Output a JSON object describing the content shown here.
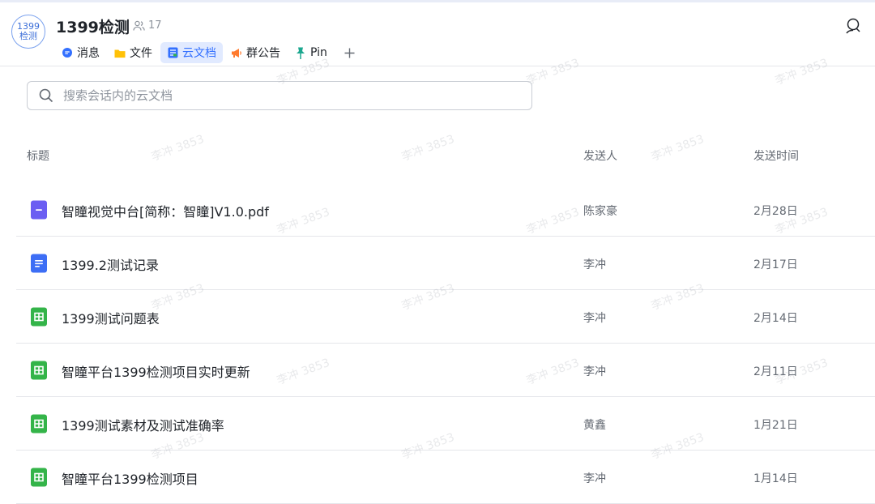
{
  "header": {
    "avatar_line1": "1399",
    "avatar_line2": "检测",
    "group_name": "1399检测",
    "member_count": "17"
  },
  "tabs": [
    {
      "label": "消息",
      "icon": "message-icon",
      "active": false
    },
    {
      "label": "文件",
      "icon": "folder-icon",
      "active": false
    },
    {
      "label": "云文档",
      "icon": "doc-icon",
      "active": true
    },
    {
      "label": "群公告",
      "icon": "announcement-icon",
      "active": false
    },
    {
      "label": "Pin",
      "icon": "pin-icon",
      "active": false
    }
  ],
  "search": {
    "placeholder": "搜索会话内的云文档"
  },
  "table": {
    "headers": {
      "title": "标题",
      "sender": "发送人",
      "time": "发送时间"
    },
    "rows": [
      {
        "type": "pdf",
        "icon": "pdf-file-icon",
        "title": "智瞳视觉中台[简称：智瞳]V1.0.pdf",
        "sender": "陈家豪",
        "time": "2月28日"
      },
      {
        "type": "doc",
        "icon": "doc-file-icon",
        "title": "1399.2测试记录",
        "sender": "李冲",
        "time": "2月17日"
      },
      {
        "type": "sheet",
        "icon": "sheet-file-icon",
        "title": "1399测试问题表",
        "sender": "李冲",
        "time": "2月14日"
      },
      {
        "type": "sheet",
        "icon": "sheet-file-icon",
        "title": "智瞳平台1399检测项目实时更新",
        "sender": "李冲",
        "time": "2月11日"
      },
      {
        "type": "sheet",
        "icon": "sheet-file-icon",
        "title": "1399测试素材及测试准确率",
        "sender": "黄鑫",
        "time": "1月21日"
      },
      {
        "type": "sheet",
        "icon": "sheet-file-icon",
        "title": "智瞳平台1399检测项目",
        "sender": "李冲",
        "time": "1月14日"
      }
    ]
  },
  "watermark": {
    "text": "李冲 3853"
  },
  "colors": {
    "accent": "#3370ff",
    "active_tab_bg": "#e1eaff",
    "pdf": "#6b5ef2",
    "doc": "#3d6ef5",
    "sheet": "#34b449",
    "announcement": "#ff7a2e",
    "pin": "#1ba78f",
    "folder": "#ffc107"
  }
}
